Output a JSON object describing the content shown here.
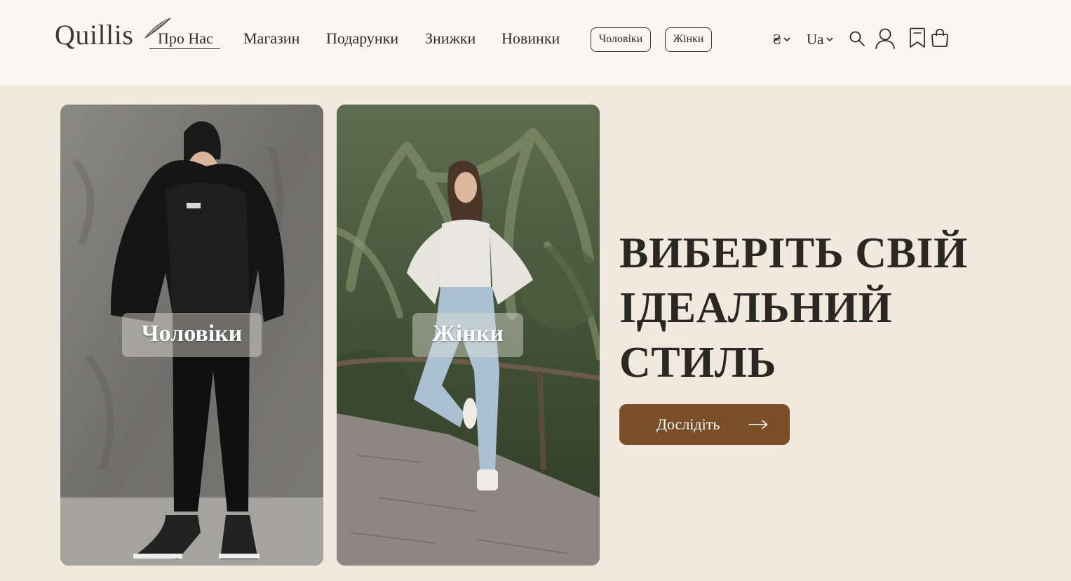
{
  "header": {
    "logo": "Quillis",
    "nav": [
      {
        "label": "Про Нас",
        "active": true
      },
      {
        "label": "Магазин",
        "active": false
      },
      {
        "label": "Подарунки",
        "active": false
      },
      {
        "label": "Знижки",
        "active": false
      },
      {
        "label": "Новинки",
        "active": false
      }
    ],
    "pills": [
      {
        "label": "Чоловіки"
      },
      {
        "label": "Жінки"
      }
    ],
    "currency": "₴",
    "language": "Ua",
    "icons": [
      "search-icon",
      "user-icon",
      "bookmark-icon",
      "shopping-bag-icon"
    ]
  },
  "hero": {
    "cards": [
      {
        "label": "Чоловіки",
        "image": "man-in-black-outfit-photo"
      },
      {
        "label": "Жінки",
        "image": "woman-in-jeans-among-palms-photo"
      }
    ],
    "headline_lines": [
      "ВИБЕРІТЬ СВІЙ",
      "ІДЕАЛЬНИЙ",
      "СТИЛЬ"
    ],
    "cta": {
      "label": "Дослідіть",
      "icon": "arrow-right-icon"
    }
  },
  "colors": {
    "header_bg": "#faf7f0",
    "page_bg": "#f1e9dd",
    "accent": "#7a4f28",
    "text": "#2b2824"
  }
}
